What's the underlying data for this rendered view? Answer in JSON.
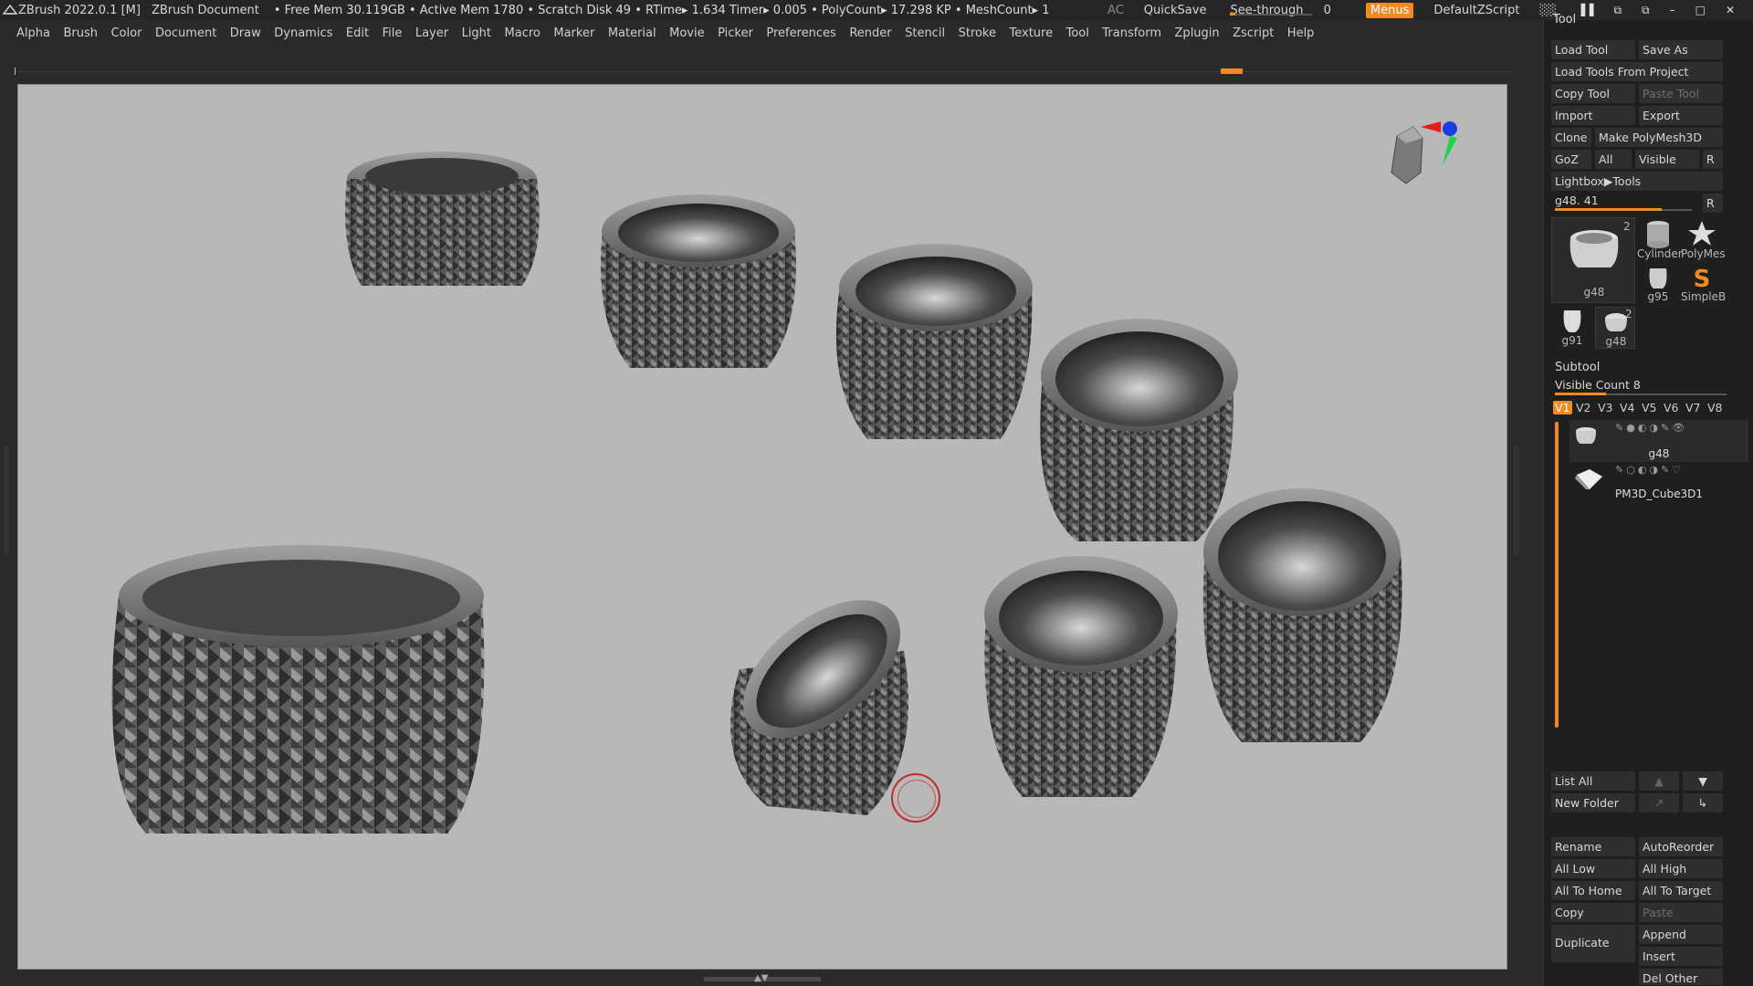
{
  "titlebar": {
    "app_title": "ZBrush 2022.0.1 [M]",
    "document": "ZBrush Document",
    "status": "• Free Mem 30.119GB • Active Mem 1780 • Scratch Disk 49 •  RTime▸ 1.634 Timer▸ 0.005 • PolyCount▸ 17.298 KP  • MeshCount▸ 1",
    "ac": "AC",
    "quicksave": "QuickSave",
    "see_through_label": "See-through",
    "see_through_value": "0",
    "see_through_level": 0.05,
    "menus": "Menus",
    "script": "DefaultZScript",
    "win_controls": [
      "░░",
      "▐▐",
      "⧉",
      "⧉",
      "–",
      "□",
      "✕"
    ]
  },
  "menubar": [
    "Alpha",
    "Brush",
    "Color",
    "Document",
    "Draw",
    "Dynamics",
    "Edit",
    "File",
    "Layer",
    "Light",
    "Macro",
    "Marker",
    "Material",
    "Movie",
    "Picker",
    "Preferences",
    "Render",
    "Stencil",
    "Stroke",
    "Texture",
    "Tool",
    "Transform",
    "Zplugin",
    "Zscript",
    "Help"
  ],
  "tool_panel": {
    "title": "Tool",
    "load_tool": "Load Tool",
    "save_as": "Save As",
    "load_from_project": "Load Tools From Project",
    "copy_tool": "Copy Tool",
    "paste_tool": "Paste Tool",
    "import": "Import",
    "export": "Export",
    "clone": "Clone",
    "make_polymesh": "Make PolyMesh3D",
    "goz": "GoZ",
    "all": "All",
    "visible": "Visible",
    "r": "R",
    "lightbox": "Lightbox▶Tools",
    "current_tool_label": "g48. 41",
    "tool_slider_level": 0.78,
    "thumbs": [
      {
        "name": "g48",
        "count": "2"
      },
      {
        "name": "Cylinder",
        "count": ""
      },
      {
        "name": "PolyMes",
        "count": ""
      },
      {
        "name": "g95",
        "count": ""
      },
      {
        "name": "SimpleB",
        "count": ""
      },
      {
        "name": "g91",
        "count": ""
      },
      {
        "name": "g48",
        "count": "2"
      }
    ]
  },
  "subtool": {
    "title": "Subtool",
    "visible_count": "Visible Count 8",
    "visible_count_level": 0.3,
    "tabs": [
      "V1",
      "V2",
      "V3",
      "V4",
      "V5",
      "V6",
      "V7",
      "V8"
    ],
    "items": [
      {
        "name": "g48"
      },
      {
        "name": "PM3D_Cube3D1"
      }
    ],
    "list_all": "List All",
    "new_folder": "New Folder",
    "rename": "Rename",
    "autoreorder": "AutoReorder",
    "all_low": "All Low",
    "all_high": "All High",
    "all_to_home": "All To Home",
    "all_to_target": "All To Target",
    "copy": "Copy",
    "paste": "Paste",
    "duplicate": "Duplicate",
    "append": "Append",
    "insert": "Insert",
    "del_other": "Del Other"
  },
  "colors": {
    "accent": "#f08a24",
    "viewport_bg": "#b8b8b8",
    "panel_bg": "#1f1f1f"
  }
}
